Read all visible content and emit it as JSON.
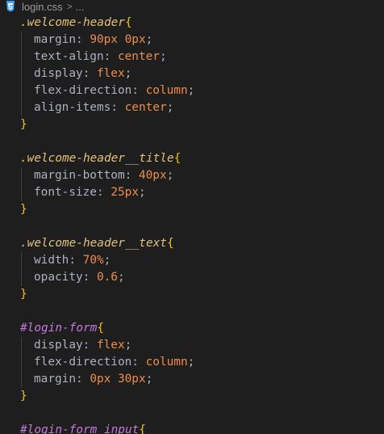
{
  "breadcrumb": {
    "file_icon": "css3-file-icon",
    "file_name": "login.css",
    "separator": ">",
    "more": "..."
  },
  "code": [
    {
      "type": "open",
      "prefix": ".",
      "selector": "welcome-header",
      "brace": "{"
    },
    {
      "type": "decl",
      "prop": "margin",
      "value": "90px 0px"
    },
    {
      "type": "decl",
      "prop": "text-align",
      "value": "center"
    },
    {
      "type": "decl",
      "prop": "display",
      "value": "flex"
    },
    {
      "type": "decl",
      "prop": "flex-direction",
      "value": "column"
    },
    {
      "type": "decl",
      "prop": "align-items",
      "value": "center"
    },
    {
      "type": "close",
      "brace": "}"
    },
    {
      "type": "blank"
    },
    {
      "type": "open",
      "prefix": ".",
      "selector": "welcome-header__title",
      "brace": "{"
    },
    {
      "type": "decl",
      "prop": "margin-bottom",
      "value": "40px"
    },
    {
      "type": "decl",
      "prop": "font-size",
      "value": "25px"
    },
    {
      "type": "close",
      "brace": "}"
    },
    {
      "type": "blank"
    },
    {
      "type": "open",
      "prefix": ".",
      "selector": "welcome-header__text",
      "brace": "{"
    },
    {
      "type": "decl",
      "prop": "width",
      "value": "70%"
    },
    {
      "type": "decl",
      "prop": "opacity",
      "value": "0.6"
    },
    {
      "type": "close",
      "brace": "}"
    },
    {
      "type": "blank"
    },
    {
      "type": "open",
      "prefix": "#",
      "selector": "login-form",
      "brace": "{"
    },
    {
      "type": "decl",
      "prop": "display",
      "value": "flex"
    },
    {
      "type": "decl",
      "prop": "flex-direction",
      "value": "column"
    },
    {
      "type": "decl",
      "prop": "margin",
      "value": "0px 30px"
    },
    {
      "type": "close",
      "brace": "}"
    },
    {
      "type": "blank"
    },
    {
      "type": "open",
      "prefix": "#",
      "selector": "login-form input",
      "brace": "{"
    }
  ],
  "colors": {
    "background": "#1e1e1e",
    "selector": "#e5c07b",
    "id_hash": "#c678dd",
    "brace": "#f1c40f",
    "property": "#abb2bf",
    "value": "#f08d49"
  }
}
